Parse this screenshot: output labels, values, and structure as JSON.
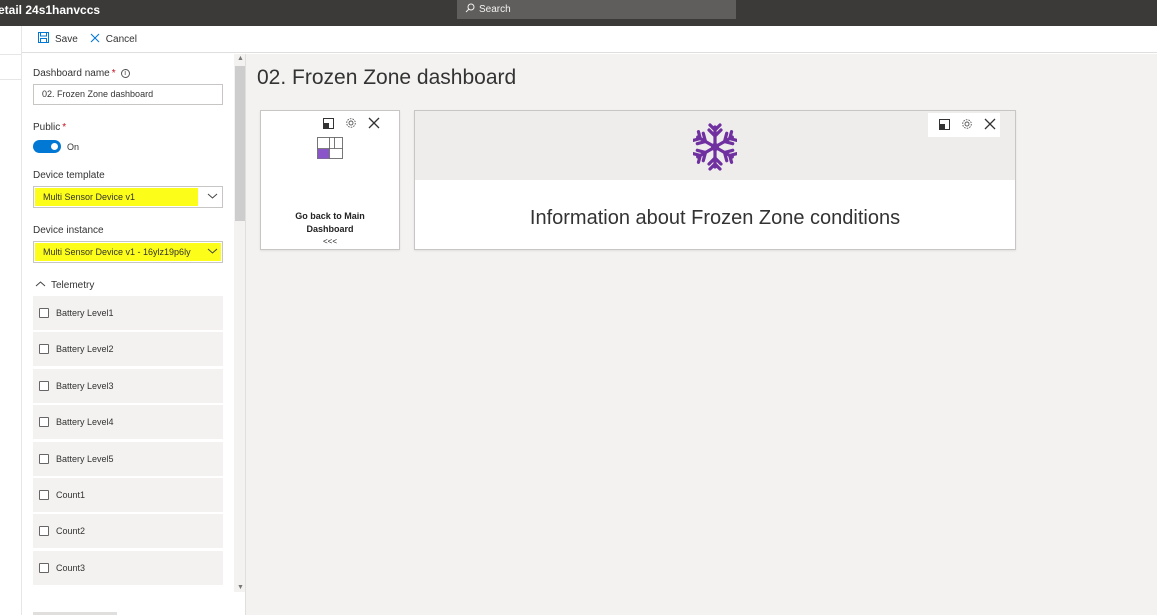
{
  "app": {
    "title": "etail 24s1hanvccs",
    "search_placeholder": "Search"
  },
  "toolbar": {
    "save_label": "Save",
    "cancel_label": "Cancel"
  },
  "settings": {
    "dashboard_name_label": "Dashboard name",
    "dashboard_name_value": "02. Frozen Zone dashboard",
    "public_label": "Public",
    "public_state": "On",
    "device_template_label": "Device template",
    "device_template_value": "Multi Sensor Device v1",
    "device_instance_label": "Device instance",
    "device_instance_value": "Multi Sensor Device v1 - 16ylz19p6ly",
    "telemetry_label": "Telemetry",
    "telemetry_items": [
      "Battery Level1",
      "Battery Level2",
      "Battery Level3",
      "Battery Level4",
      "Battery Level5",
      "Count1",
      "Count2",
      "Count3"
    ]
  },
  "dashboard": {
    "title": "02. Frozen Zone dashboard",
    "link_tile": {
      "line1": "Go back to Main",
      "line2": "Dashboard",
      "sub": "<<<"
    },
    "image_tile": {
      "text": "Information about Frozen Zone conditions"
    }
  },
  "colors": {
    "accent": "#0078d4",
    "highlight": "#fdfd1a",
    "snowflake": "#7030a0",
    "topbar": "#3b3a39"
  },
  "icons": [
    "search-icon",
    "save-icon",
    "cancel-icon",
    "info-icon",
    "chevron-down-icon",
    "chevron-up-icon",
    "resize-icon",
    "gear-icon",
    "close-icon",
    "dashboard-link-icon",
    "snowflake-icon"
  ]
}
